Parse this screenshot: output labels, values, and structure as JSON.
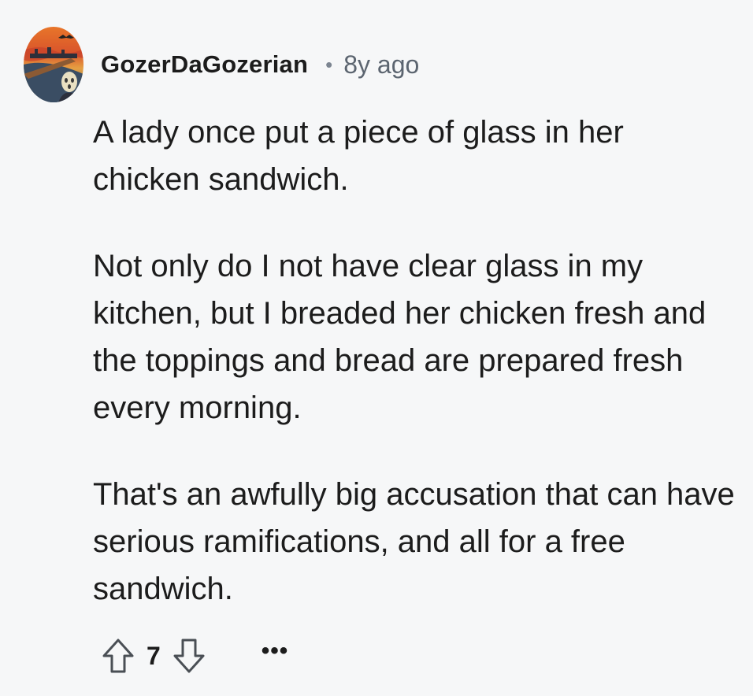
{
  "comment": {
    "author": "GozerDaGozerian",
    "separator": "•",
    "age": "8y ago",
    "avatar_icon": "avatar-scream-painting",
    "paragraphs": [
      "A lady once put a piece of glass in her chicken sandwich.",
      "Not only do I not have clear glass in my kitchen, but I breaded her chicken fresh and the toppings and bread are prepared fresh every morning.",
      "That's an awfully big accusation that can have serious ramifications, and all for a free sandwich."
    ],
    "score": "7",
    "more_label": "•••"
  },
  "icons": {
    "upvote": "upvote-arrow-icon",
    "downvote": "downvote-arrow-icon",
    "more": "more-options-icon"
  },
  "colors": {
    "background": "#f6f7f8",
    "text": "#1c1c1c",
    "muted": "#5c6570",
    "icon_stroke": "#4a4f55"
  }
}
